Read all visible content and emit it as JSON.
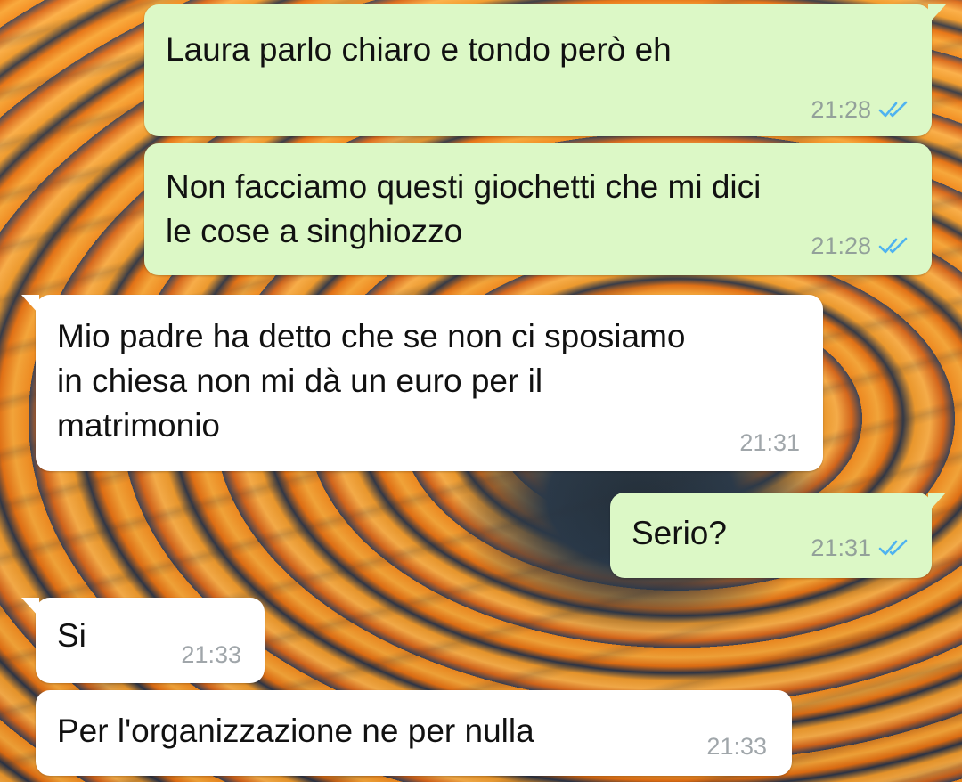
{
  "messages": [
    {
      "direction": "sent",
      "text": "Laura parlo chiaro e tondo però eh",
      "time": "21:28",
      "status": "read"
    },
    {
      "direction": "sent",
      "text": "Non facciamo questi giochetti che mi dici\nle cose a singhiozzo",
      "time": "21:28",
      "status": "read"
    },
    {
      "direction": "received",
      "text": "Mio padre ha detto che se non ci sposiamo\nin chiesa non mi dà un euro per il\nmatrimonio",
      "time": "21:31"
    },
    {
      "direction": "sent",
      "text": "Serio?",
      "time": "21:31",
      "status": "read"
    },
    {
      "direction": "received",
      "text": "Si",
      "time": "21:33"
    },
    {
      "direction": "received",
      "text": "Per l'organizzazione ne per nulla",
      "time": "21:33"
    }
  ],
  "colors": {
    "sent_bubble": "#dcf8c6",
    "received_bubble": "#ffffff",
    "read_check": "#4fb3f0",
    "timestamp": "#93a19a",
    "wallpaper_orange": "#f28a1f",
    "wallpaper_dark": "#24364a"
  },
  "icons": {
    "read_receipt": "double-check-icon"
  }
}
